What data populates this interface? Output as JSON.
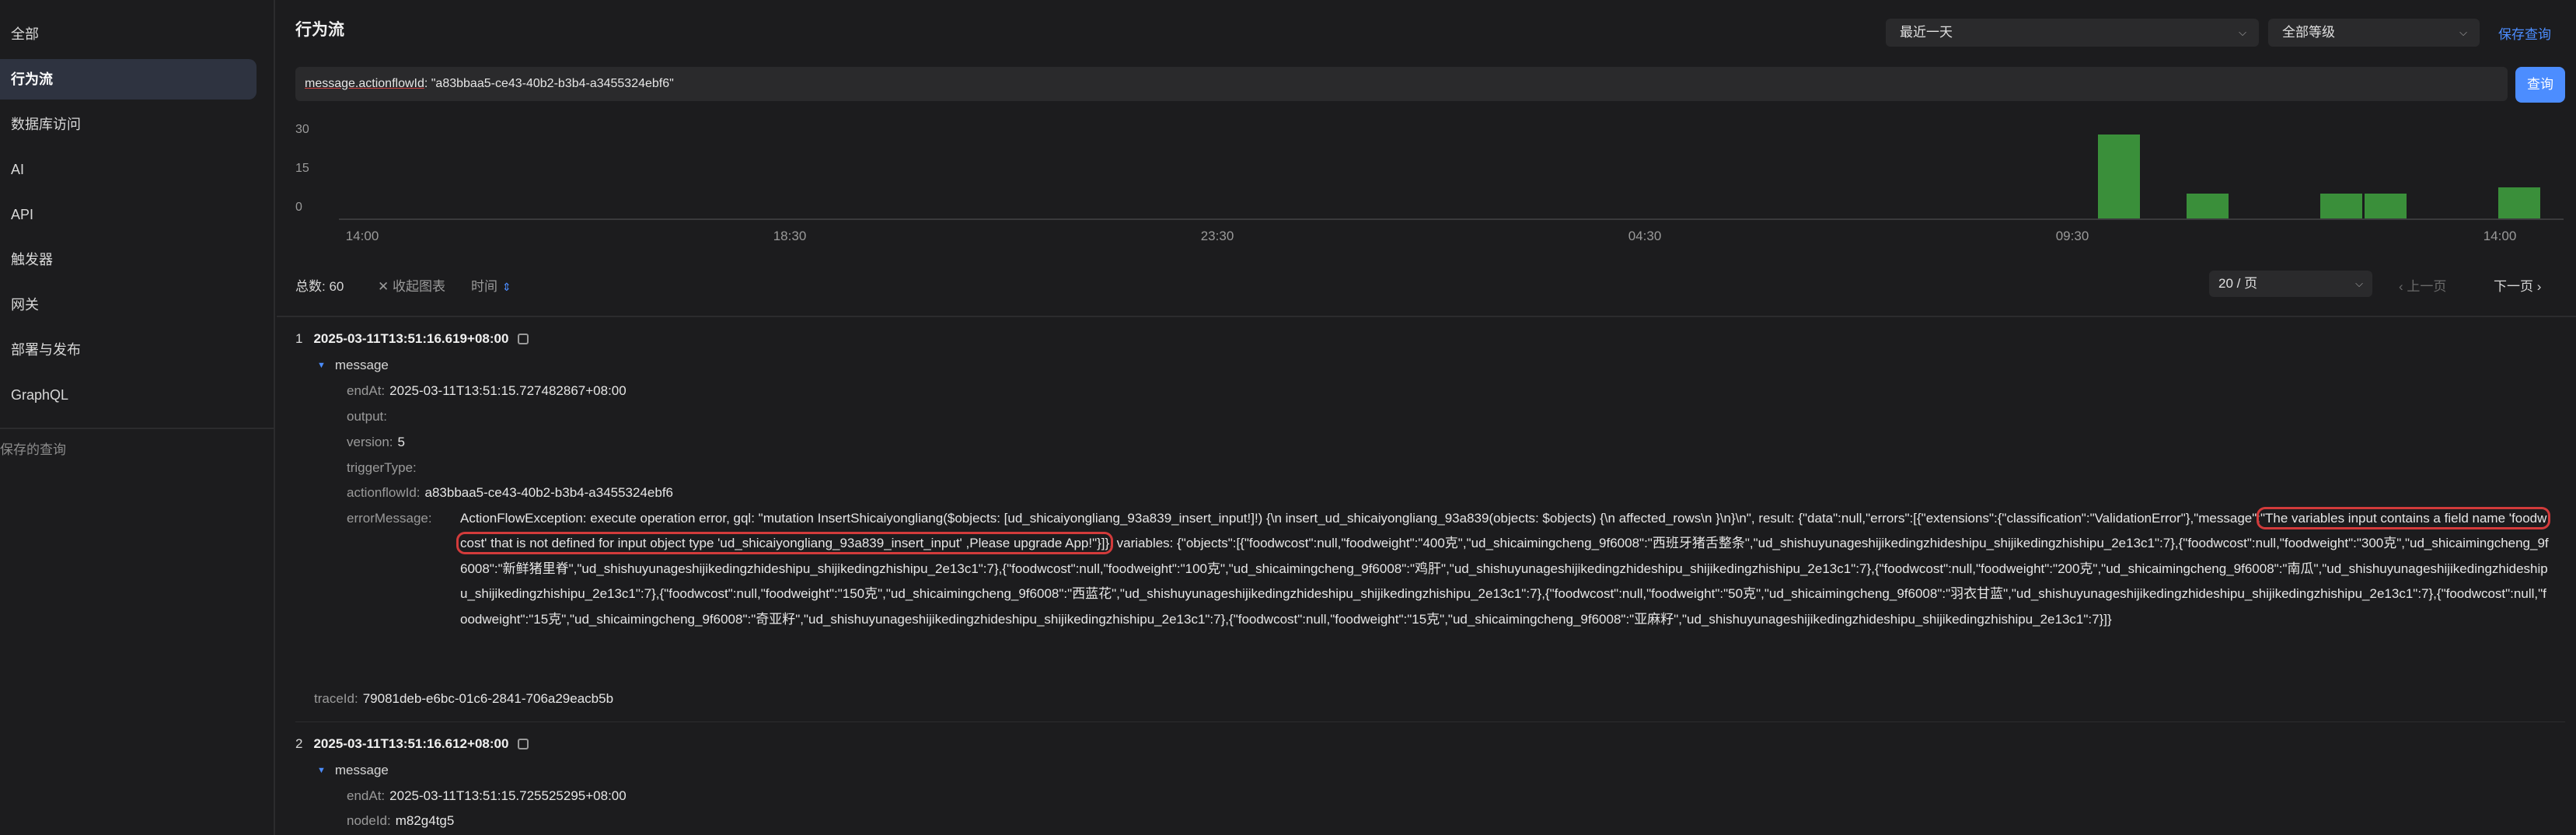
{
  "sidebar": {
    "items": [
      {
        "label": "全部",
        "active": false
      },
      {
        "label": "行为流",
        "active": true
      },
      {
        "label": "数据库访问",
        "active": false
      },
      {
        "label": "AI",
        "active": false
      },
      {
        "label": "API",
        "active": false
      },
      {
        "label": "触发器",
        "active": false
      },
      {
        "label": "网关",
        "active": false
      },
      {
        "label": "部署与发布",
        "active": false
      },
      {
        "label": "GraphQL",
        "active": false
      }
    ],
    "saved_queries_label": "保存的查询"
  },
  "header": {
    "title": "行为流",
    "time_range": "最近一天",
    "level": "全部等级",
    "save_query": "保存查询"
  },
  "query": {
    "key": "message.actionflowId",
    "rest": ": \"a83bbaa5-ce43-40b2-b3b4-a3455324ebf6\"",
    "button": "查询"
  },
  "chart_data": {
    "type": "bar",
    "yticks": [
      "30",
      "15",
      "0"
    ],
    "ylim": [
      0,
      30
    ],
    "xticks": [
      "14:00",
      "18:30",
      "23:30",
      "04:30",
      "09:30",
      "14:00"
    ],
    "bars": [
      {
        "slot": 0.8,
        "value": 30
      },
      {
        "slot": 0.84,
        "value": 9
      },
      {
        "slot": 0.9,
        "value": 9
      },
      {
        "slot": 0.92,
        "value": 9
      },
      {
        "slot": 0.98,
        "value": 11
      }
    ],
    "color": "#3a8f3a"
  },
  "toolbar": {
    "total_label": "总数:",
    "total": "60",
    "collapse": "收起图表",
    "time": "时间",
    "page_size": "20 / 页",
    "prev": "上一页",
    "next": "下一页"
  },
  "records": [
    {
      "index": "1",
      "timestamp": "2025-03-11T13:51:16.619+08:00",
      "message_label": "message",
      "endAt": "2025-03-11T13:51:15.727482867+08:00",
      "output": "",
      "version": "5",
      "triggerType": "",
      "actionflowId": "a83bbaa5-ce43-40b2-b3b4-a3455324ebf6",
      "error_pre": "ActionFlowException: execute operation error, gql: \"mutation InsertShicaiyongliang($objects: [ud_shicaiyongliang_93a839_insert_input!]!) {\\n  insert_ud_shicaiyongliang_93a839(objects: $objects) {\\n    affected_rows\\n  }\\n}\\n\", result: {\"data\":null,\"errors\":[{\"extensions\":{\"classification\":\"ValidationError\"},\"message\":",
      "error_highlight": "\"The variables input contains a field name 'foodwcost' that is not defined for input object type 'ud_shicaiyongliang_93a839_insert_input' ,Please upgrade App!\"}]}",
      "error_post": ", variables: {\"objects\":[{\"foodwcost\":null,\"foodweight\":\"400克\",\"ud_shicaimingcheng_9f6008\":\"西班牙猪舌整条\",\"ud_shishuyunageshijikedingzhideshipu_shijikedingzhishipu_2e13c1\":7},{\"foodwcost\":null,\"foodweight\":\"300克\",\"ud_shicaimingcheng_9f6008\":\"新鲜猪里脊\",\"ud_shishuyunageshijikedingzhideshipu_shijikedingzhishipu_2e13c1\":7},{\"foodwcost\":null,\"foodweight\":\"100克\",\"ud_shicaimingcheng_9f6008\":\"鸡肝\",\"ud_shishuyunageshijikedingzhideshipu_shijikedingzhishipu_2e13c1\":7},{\"foodwcost\":null,\"foodweight\":\"200克\",\"ud_shicaimingcheng_9f6008\":\"南瓜\",\"ud_shishuyunageshijikedingzhideshipu_shijikedingzhishipu_2e13c1\":7},{\"foodwcost\":null,\"foodweight\":\"150克\",\"ud_shicaimingcheng_9f6008\":\"西蓝花\",\"ud_shishuyunageshijikedingzhideshipu_shijikedingzhishipu_2e13c1\":7},{\"foodwcost\":null,\"foodweight\":\"50克\",\"ud_shicaimingcheng_9f6008\":\"羽衣甘蓝\",\"ud_shishuyunageshijikedingzhideshipu_shijikedingzhishipu_2e13c1\":7},{\"foodwcost\":null,\"foodweight\":\"15克\",\"ud_shicaimingcheng_9f6008\":\"奇亚籽\",\"ud_shishuyunageshijikedingzhideshipu_shijikedingzhishipu_2e13c1\":7},{\"foodwcost\":null,\"foodweight\":\"15克\",\"ud_shicaimingcheng_9f6008\":\"亚麻籽\",\"ud_shishuyunageshijikedingzhideshipu_shijikedingzhishipu_2e13c1\":7}]}",
      "traceId": "79081deb-e6bc-01c6-2841-706a29eacb5b"
    },
    {
      "index": "2",
      "timestamp": "2025-03-11T13:51:16.612+08:00",
      "message_label": "message",
      "endAt": "2025-03-11T13:51:15.725525295+08:00",
      "nodeId": "m82g4tg5"
    }
  ],
  "field_keys": {
    "endAt": "endAt:",
    "output": "output:",
    "version": "version:",
    "triggerType": "triggerType:",
    "actionflowId": "actionflowId:",
    "errorMessage": "errorMessage:",
    "traceId": "traceId:",
    "nodeId": "nodeId:"
  }
}
